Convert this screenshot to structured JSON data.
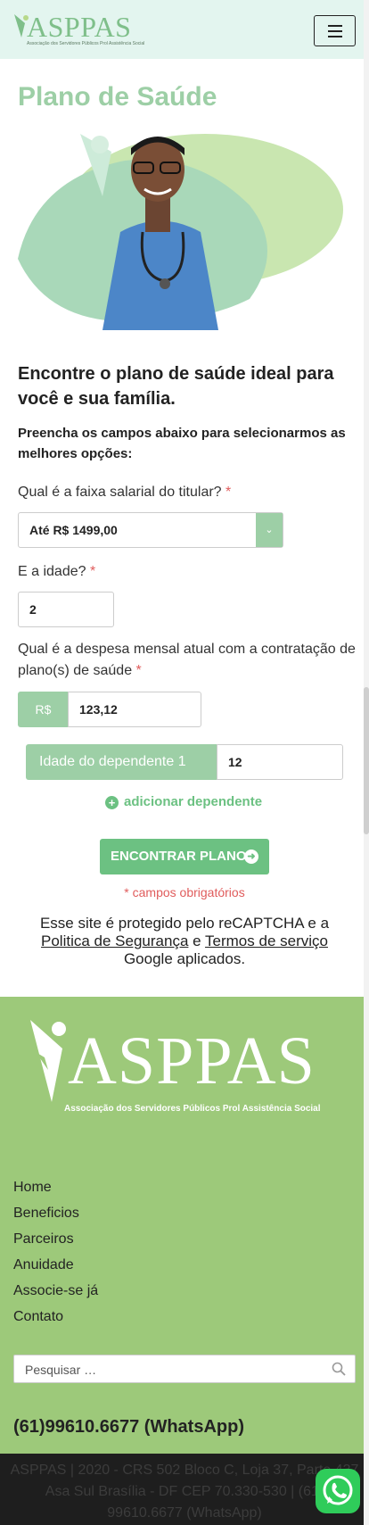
{
  "header": {
    "logo_text": "ASPPAS",
    "logo_subtitle": "Associação dos Servidores Públicos Prol Assistência Social"
  },
  "page": {
    "title": "Plano de Saúde",
    "heading": "Encontre o plano de saúde ideal para você e sua família.",
    "subheading": "Preencha os campos abaixo para selecionarmos as melhores opções:"
  },
  "form": {
    "salary_label": "Qual é a faixa salarial do titular?",
    "salary_value": "Até R$ 1499,00",
    "age_label": "E a idade?",
    "age_value": "2",
    "expense_label": "Qual é a despesa mensal atual com a contratação de plano(s) de saúde",
    "currency_prefix": "R$",
    "expense_value": "123,12",
    "dependent_label": "Idade do dependente 1",
    "dependent_value": "12",
    "add_dependent": "adicionar dependente",
    "submit_label": "ENCONTRAR PLANOS",
    "required_mark": "*",
    "required_note": "* campos obrigatórios"
  },
  "recaptcha": {
    "text_before": "Esse site é protegido pelo reCAPTCHA e a",
    "privacy_link": "Politica de Segurança",
    "and": "e",
    "terms_link": "Termos de serviço",
    "text_after": "Google aplicados."
  },
  "footer": {
    "logo_text": "ASPPAS",
    "logo_subtitle": "Associação dos Servidores Públicos Prol Assistência Social",
    "menu": [
      "Home",
      "Beneficios",
      "Parceiros",
      "Anuidade",
      "Associe-se já",
      "Contato"
    ],
    "search_placeholder": "Pesquisar …",
    "phone": "(61)99610.6677 (WhatsApp)",
    "bottom_text": "ASPPAS | 2020 - CRS 502 Bloco C, Loja 37, Parte 437 Asa Sul Brasília - DF CEP 70.330-530 | (61) 99610.6677 (WhatsApp)"
  },
  "colors": {
    "brand_green": "#9dcfa6",
    "button_green": "#6cc182",
    "footer_green": "#9dc97a",
    "header_bg": "#e3f5ef",
    "required_red": "#e05c5c"
  }
}
